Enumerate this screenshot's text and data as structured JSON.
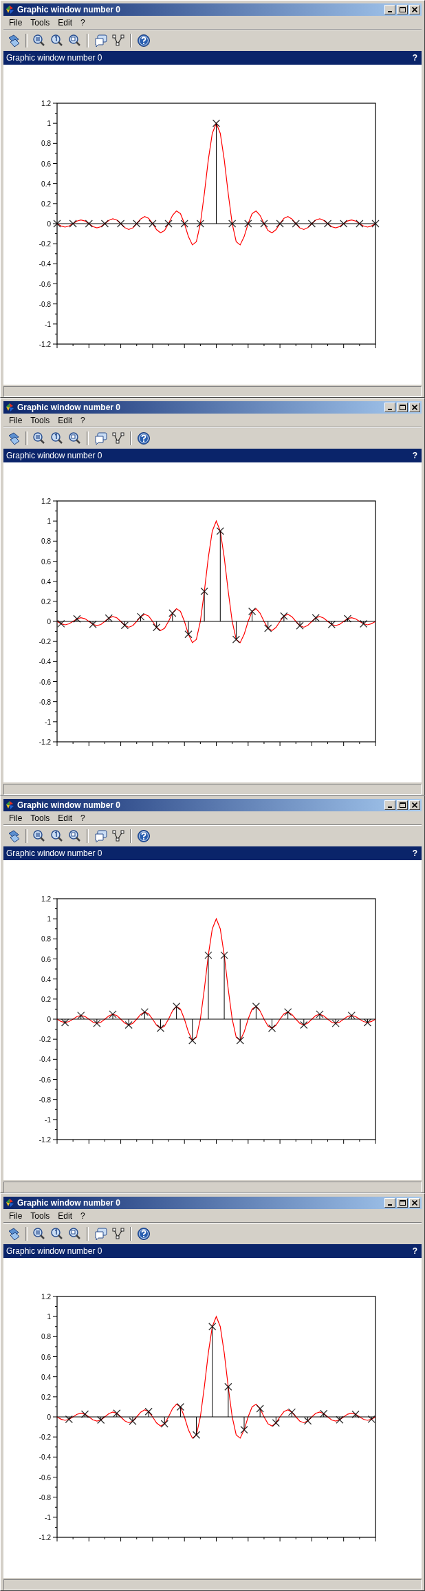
{
  "windows": [
    {
      "title": "Graphic window number 0",
      "menu": [
        "File",
        "Tools",
        "Edit",
        "?"
      ],
      "panel_title": "Graphic window number 0",
      "panel_help": "?",
      "chart_data": {
        "type": "line",
        "ylim": [
          -1.2,
          1.2
        ],
        "yticks": [
          -1.2,
          -1,
          -0.8,
          -0.6,
          -0.4,
          -0.2,
          0,
          0.2,
          0.4,
          0.6,
          0.8,
          1,
          1.2
        ],
        "categories": [
          null,
          null,
          null,
          null,
          null,
          null,
          null,
          null,
          null,
          null,
          null,
          null,
          null,
          null,
          null,
          null,
          null,
          null,
          null,
          null,
          null,
          null,
          null,
          null,
          null,
          null,
          null,
          null,
          null,
          null,
          null,
          null,
          null,
          null,
          null,
          null,
          null,
          null,
          null,
          null,
          null,
          null,
          null,
          null,
          null,
          null,
          null,
          null,
          null,
          null,
          null,
          null,
          null,
          null,
          null,
          null,
          null,
          null,
          null,
          null,
          null,
          null,
          null,
          null,
          null,
          null,
          null,
          null,
          null,
          null,
          null,
          null,
          null,
          null,
          null,
          null,
          null,
          null,
          null,
          null,
          null
        ],
        "series": [
          {
            "color": "#ff0000",
            "values": [
              0,
              -0.023,
              -0.034,
              -0.024,
              0,
              0.026,
              0.037,
              0.027,
              0,
              -0.029,
              -0.042,
              -0.031,
              0,
              0.033,
              0.049,
              0.036,
              0,
              -0.039,
              -0.058,
              -0.043,
              0,
              0.047,
              0.071,
              0.053,
              0,
              -0.06,
              -0.091,
              -0.069,
              0,
              0.082,
              0.127,
              0.1,
              0,
              -0.129,
              -0.212,
              -0.18,
              0,
              0.3,
              0.637,
              0.9,
              1,
              0.9,
              0.637,
              0.3,
              0,
              -0.18,
              -0.212,
              -0.129,
              0,
              0.1,
              0.127,
              0.082,
              0,
              -0.069,
              -0.091,
              -0.06,
              0,
              0.053,
              0.071,
              0.047,
              0,
              -0.043,
              -0.058,
              -0.039,
              0,
              0.036,
              0.049,
              0.033,
              0,
              -0.031,
              -0.042,
              -0.029,
              0,
              0.027,
              0.037,
              0.026,
              0,
              -0.024,
              -0.034,
              -0.023,
              0
            ]
          },
          {
            "color": "#000000",
            "marker": "x",
            "values": [
              0,
              null,
              null,
              null,
              0,
              null,
              null,
              null,
              0,
              null,
              null,
              null,
              0,
              null,
              null,
              null,
              0,
              null,
              null,
              null,
              0,
              null,
              null,
              null,
              0,
              null,
              null,
              null,
              0,
              null,
              null,
              null,
              0,
              null,
              null,
              null,
              0,
              null,
              null,
              null,
              1,
              null,
              null,
              null,
              0,
              null,
              null,
              null,
              0,
              null,
              null,
              null,
              0,
              null,
              null,
              null,
              0,
              null,
              null,
              null,
              0,
              null,
              null,
              null,
              0,
              null,
              null,
              null,
              0,
              null,
              null,
              null,
              0,
              null,
              null,
              null,
              0,
              null,
              null,
              null,
              0
            ]
          }
        ]
      }
    },
    {
      "title": "Graphic window number 0",
      "menu": [
        "File",
        "Tools",
        "Edit",
        "?"
      ],
      "panel_title": "Graphic window number 0",
      "panel_help": "?",
      "chart_data": {
        "type": "line",
        "ylim": [
          -1.2,
          1.2
        ],
        "yticks": [
          -1.2,
          -1,
          -0.8,
          -0.6,
          -0.4,
          -0.2,
          0,
          0.2,
          0.4,
          0.6,
          0.8,
          1,
          1.2
        ],
        "categories": [
          null,
          null,
          null,
          null,
          null,
          null,
          null,
          null,
          null,
          null,
          null,
          null,
          null,
          null,
          null,
          null,
          null,
          null,
          null,
          null,
          null,
          null,
          null,
          null,
          null,
          null,
          null,
          null,
          null,
          null,
          null,
          null,
          null,
          null,
          null,
          null,
          null,
          null,
          null,
          null,
          null,
          null,
          null,
          null,
          null,
          null,
          null,
          null,
          null,
          null,
          null,
          null,
          null,
          null,
          null,
          null,
          null,
          null,
          null,
          null,
          null,
          null,
          null,
          null,
          null,
          null,
          null,
          null,
          null,
          null,
          null,
          null,
          null,
          null,
          null,
          null,
          null,
          null,
          null,
          null,
          null
        ],
        "series": [
          {
            "color": "#ff0000",
            "values": [
              0,
              -0.023,
              -0.034,
              -0.024,
              0,
              0.026,
              0.037,
              0.027,
              0,
              -0.029,
              -0.042,
              -0.031,
              0,
              0.033,
              0.049,
              0.036,
              0,
              -0.039,
              -0.058,
              -0.043,
              0,
              0.047,
              0.071,
              0.053,
              0,
              -0.06,
              -0.091,
              -0.069,
              0,
              0.082,
              0.127,
              0.1,
              0,
              -0.129,
              -0.212,
              -0.18,
              0,
              0.3,
              0.637,
              0.9,
              1,
              0.9,
              0.637,
              0.3,
              0,
              -0.18,
              -0.212,
              -0.129,
              0,
              0.1,
              0.127,
              0.082,
              0,
              -0.069,
              -0.091,
              -0.06,
              0,
              0.053,
              0.071,
              0.047,
              0,
              -0.043,
              -0.058,
              -0.039,
              0,
              0.036,
              0.049,
              0.033,
              0,
              -0.031,
              -0.042,
              -0.029,
              0,
              0.027,
              0.037,
              0.026,
              0,
              -0.024,
              -0.034,
              -0.023,
              0
            ]
          },
          {
            "color": "#000000",
            "marker": "x",
            "values": [
              null,
              -0.023,
              null,
              null,
              null,
              0.026,
              null,
              null,
              null,
              -0.029,
              null,
              null,
              null,
              0.033,
              null,
              null,
              null,
              -0.039,
              null,
              null,
              null,
              0.047,
              null,
              null,
              null,
              -0.06,
              null,
              null,
              null,
              0.082,
              null,
              null,
              null,
              -0.129,
              null,
              null,
              null,
              0.3,
              null,
              null,
              null,
              0.9,
              null,
              null,
              null,
              -0.18,
              null,
              null,
              null,
              0.1,
              null,
              null,
              null,
              -0.069,
              null,
              null,
              null,
              0.053,
              null,
              null,
              null,
              -0.043,
              null,
              null,
              null,
              0.036,
              null,
              null,
              null,
              -0.031,
              null,
              null,
              null,
              0.027,
              null,
              null,
              null,
              -0.024,
              null,
              null,
              null
            ]
          }
        ]
      }
    },
    {
      "title": "Graphic window number 0",
      "menu": [
        "File",
        "Tools",
        "Edit",
        "?"
      ],
      "panel_title": "Graphic window number 0",
      "panel_help": "?",
      "chart_data": {
        "type": "line",
        "ylim": [
          -1.2,
          1.2
        ],
        "yticks": [
          -1.2,
          -1,
          -0.8,
          -0.6,
          -0.4,
          -0.2,
          0,
          0.2,
          0.4,
          0.6,
          0.8,
          1,
          1.2
        ],
        "categories": [
          null,
          null,
          null,
          null,
          null,
          null,
          null,
          null,
          null,
          null,
          null,
          null,
          null,
          null,
          null,
          null,
          null,
          null,
          null,
          null,
          null,
          null,
          null,
          null,
          null,
          null,
          null,
          null,
          null,
          null,
          null,
          null,
          null,
          null,
          null,
          null,
          null,
          null,
          null,
          null,
          null,
          null,
          null,
          null,
          null,
          null,
          null,
          null,
          null,
          null,
          null,
          null,
          null,
          null,
          null,
          null,
          null,
          null,
          null,
          null,
          null,
          null,
          null,
          null,
          null,
          null,
          null,
          null,
          null,
          null,
          null,
          null,
          null,
          null,
          null,
          null,
          null,
          null,
          null,
          null,
          null
        ],
        "series": [
          {
            "color": "#ff0000",
            "values": [
              0,
              -0.023,
              -0.034,
              -0.024,
              0,
              0.026,
              0.037,
              0.027,
              0,
              -0.029,
              -0.042,
              -0.031,
              0,
              0.033,
              0.049,
              0.036,
              0,
              -0.039,
              -0.058,
              -0.043,
              0,
              0.047,
              0.071,
              0.053,
              0,
              -0.06,
              -0.091,
              -0.069,
              0,
              0.082,
              0.127,
              0.1,
              0,
              -0.129,
              -0.212,
              -0.18,
              0,
              0.3,
              0.637,
              0.9,
              1,
              0.9,
              0.637,
              0.3,
              0,
              -0.18,
              -0.212,
              -0.129,
              0,
              0.1,
              0.127,
              0.082,
              0,
              -0.069,
              -0.091,
              -0.06,
              0,
              0.053,
              0.071,
              0.047,
              0,
              -0.043,
              -0.058,
              -0.039,
              0,
              0.036,
              0.049,
              0.033,
              0,
              -0.031,
              -0.042,
              -0.029,
              0,
              0.027,
              0.037,
              0.026,
              0,
              -0.024,
              -0.034,
              -0.023,
              0
            ]
          },
          {
            "color": "#000000",
            "marker": "x",
            "values": [
              null,
              null,
              -0.034,
              null,
              null,
              null,
              0.037,
              null,
              null,
              null,
              -0.042,
              null,
              null,
              null,
              0.049,
              null,
              null,
              null,
              -0.058,
              null,
              null,
              null,
              0.071,
              null,
              null,
              null,
              -0.091,
              null,
              null,
              null,
              0.127,
              null,
              null,
              null,
              -0.212,
              null,
              null,
              null,
              0.637,
              null,
              null,
              null,
              0.637,
              null,
              null,
              null,
              -0.212,
              null,
              null,
              null,
              0.127,
              null,
              null,
              null,
              -0.091,
              null,
              null,
              null,
              0.071,
              null,
              null,
              null,
              -0.058,
              null,
              null,
              null,
              0.049,
              null,
              null,
              null,
              -0.042,
              null,
              null,
              null,
              0.037,
              null,
              null,
              null,
              -0.034,
              null,
              null
            ]
          }
        ]
      }
    },
    {
      "title": "Graphic window number 0",
      "menu": [
        "File",
        "Tools",
        "Edit",
        "?"
      ],
      "panel_title": "Graphic window number 0",
      "panel_help": "?",
      "chart_data": {
        "type": "line",
        "ylim": [
          -1.2,
          1.2
        ],
        "yticks": [
          -1.2,
          -1,
          -0.8,
          -0.6,
          -0.4,
          -0.2,
          0,
          0.2,
          0.4,
          0.6,
          0.8,
          1,
          1.2
        ],
        "categories": [
          null,
          null,
          null,
          null,
          null,
          null,
          null,
          null,
          null,
          null,
          null,
          null,
          null,
          null,
          null,
          null,
          null,
          null,
          null,
          null,
          null,
          null,
          null,
          null,
          null,
          null,
          null,
          null,
          null,
          null,
          null,
          null,
          null,
          null,
          null,
          null,
          null,
          null,
          null,
          null,
          null,
          null,
          null,
          null,
          null,
          null,
          null,
          null,
          null,
          null,
          null,
          null,
          null,
          null,
          null,
          null,
          null,
          null,
          null,
          null,
          null,
          null,
          null,
          null,
          null,
          null,
          null,
          null,
          null,
          null,
          null,
          null,
          null,
          null,
          null,
          null,
          null,
          null,
          null,
          null,
          null
        ],
        "series": [
          {
            "color": "#ff0000",
            "values": [
              0,
              -0.023,
              -0.034,
              -0.024,
              0,
              0.026,
              0.037,
              0.027,
              0,
              -0.029,
              -0.042,
              -0.031,
              0,
              0.033,
              0.049,
              0.036,
              0,
              -0.039,
              -0.058,
              -0.043,
              0,
              0.047,
              0.071,
              0.053,
              0,
              -0.06,
              -0.091,
              -0.069,
              0,
              0.082,
              0.127,
              0.1,
              0,
              -0.129,
              -0.212,
              -0.18,
              0,
              0.3,
              0.637,
              0.9,
              1,
              0.9,
              0.637,
              0.3,
              0,
              -0.18,
              -0.212,
              -0.129,
              0,
              0.1,
              0.127,
              0.082,
              0,
              -0.069,
              -0.091,
              -0.06,
              0,
              0.053,
              0.071,
              0.047,
              0,
              -0.043,
              -0.058,
              -0.039,
              0,
              0.036,
              0.049,
              0.033,
              0,
              -0.031,
              -0.042,
              -0.029,
              0,
              0.027,
              0.037,
              0.026,
              0,
              -0.024,
              -0.034,
              -0.023,
              0
            ]
          },
          {
            "color": "#000000",
            "marker": "x",
            "values": [
              null,
              null,
              null,
              -0.024,
              null,
              null,
              null,
              0.027,
              null,
              null,
              null,
              -0.031,
              null,
              null,
              null,
              0.036,
              null,
              null,
              null,
              -0.043,
              null,
              null,
              null,
              0.053,
              null,
              null,
              null,
              -0.069,
              null,
              null,
              null,
              0.1,
              null,
              null,
              null,
              -0.18,
              null,
              null,
              null,
              0.9,
              null,
              null,
              null,
              0.3,
              null,
              null,
              null,
              -0.129,
              null,
              null,
              null,
              0.082,
              null,
              null,
              null,
              -0.06,
              null,
              null,
              null,
              0.047,
              null,
              null,
              null,
              -0.039,
              null,
              null,
              null,
              0.033,
              null,
              null,
              null,
              -0.029,
              null,
              null,
              null,
              0.026,
              null,
              null,
              null,
              -0.023,
              null
            ]
          }
        ]
      }
    }
  ]
}
